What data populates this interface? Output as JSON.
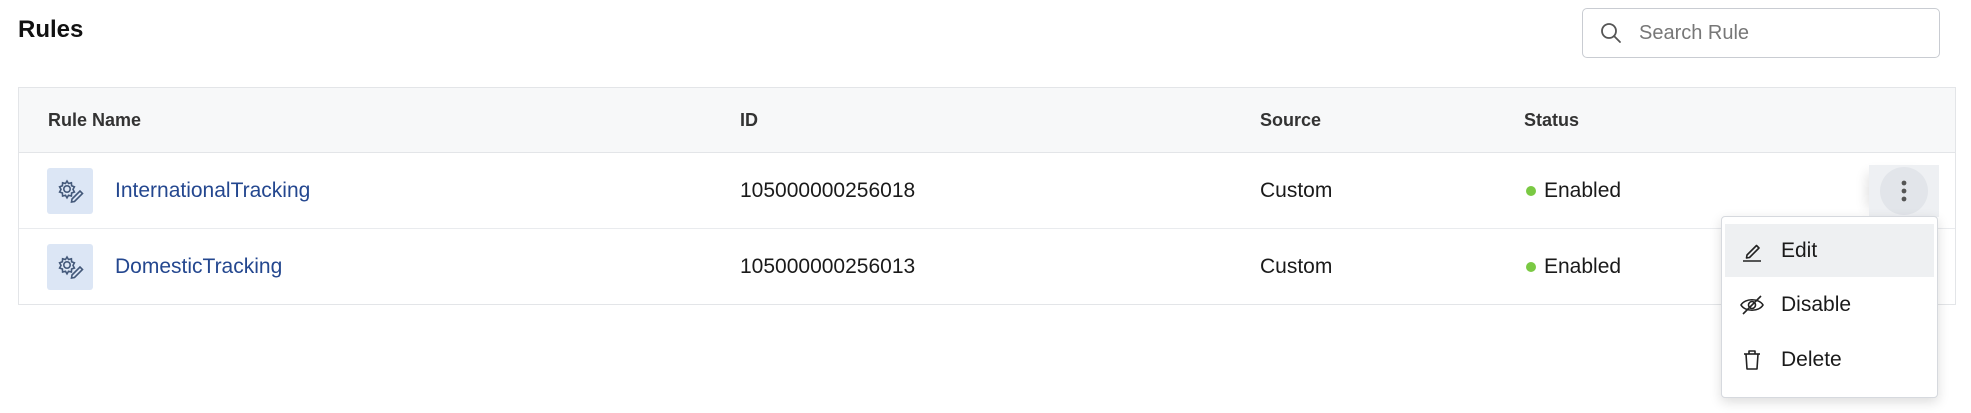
{
  "page": {
    "title": "Rules"
  },
  "search": {
    "placeholder": "Search Rule",
    "value": ""
  },
  "table": {
    "columns": [
      "Rule Name",
      "ID",
      "Source",
      "Status"
    ],
    "rows": [
      {
        "name": "InternationalTracking",
        "id": "105000000256018",
        "source": "Custom",
        "status": "Enabled",
        "icon": "gear-pencil-icon"
      },
      {
        "name": "DomesticTracking",
        "id": "105000000256013",
        "source": "Custom",
        "status": "Enabled",
        "icon": "gear-pencil-icon"
      }
    ]
  },
  "row_menu": {
    "items": [
      {
        "label": "Edit",
        "icon": "edit-pencil-icon"
      },
      {
        "label": "Disable",
        "icon": "eye-slash-icon"
      },
      {
        "label": "Delete",
        "icon": "trash-icon"
      }
    ]
  },
  "colors": {
    "accent_link": "#24478f",
    "status_enabled": "#7ac943",
    "header_bg": "#f7f8f9",
    "icon_bg": "#dce6f5"
  }
}
